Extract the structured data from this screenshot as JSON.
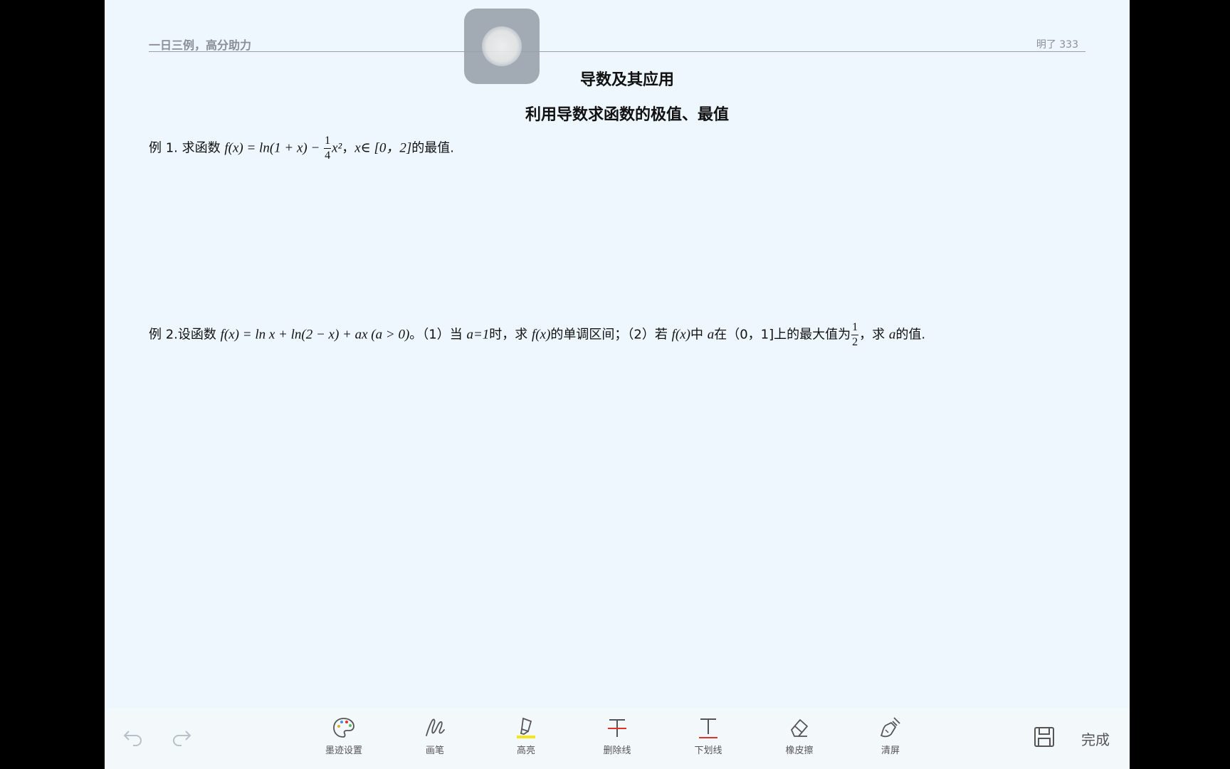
{
  "header": {
    "left": "一日三例，高分助力",
    "right": "明了 333"
  },
  "titles": {
    "main": "导数及其应用",
    "sub": "利用导数求函数的极值、最值"
  },
  "example1": {
    "prefix": "例 1. 求函数",
    "formula_a": "f(x) = ln(1 + x) − ",
    "frac_num": "1",
    "frac_den": "4",
    "formula_b": "x²",
    "comma": "，",
    "domain": "x∈ [0，2]",
    "suffix": "的最值."
  },
  "example2": {
    "prefix": "例 2.设函数",
    "formula": "f(x) = ln x + ln(2 − x) + ax (a > 0)",
    "part1a": "。（1）当",
    "a_eq": "a=1",
    "part1b": "时，求",
    "fx1": "f(x)",
    "part1c": "的单调区间；（2）若",
    "fx2": "f(x)",
    "part2a": "中",
    "a1": "a",
    "part2b": "在（0，1]上的最大值为",
    "frac_num": "1",
    "frac_den": "2",
    "part2c": "，求",
    "a2": "a",
    "part2d": "的值."
  },
  "toolbar": {
    "undo": "undo-icon",
    "redo": "redo-icon",
    "tools": [
      {
        "label": "墨迹设置",
        "icon": "palette-icon"
      },
      {
        "label": "画笔",
        "icon": "pen-icon"
      },
      {
        "label": "高亮",
        "icon": "highlighter-icon",
        "accent": "#f5e51c"
      },
      {
        "label": "删除线",
        "icon": "strikethrough-icon",
        "accent": "#e0312b"
      },
      {
        "label": "下划线",
        "icon": "underline-icon",
        "accent": "#e0312b"
      },
      {
        "label": "橡皮擦",
        "icon": "eraser-icon"
      },
      {
        "label": "清屏",
        "icon": "broom-icon"
      }
    ],
    "save": "save-icon",
    "done": "完成"
  }
}
